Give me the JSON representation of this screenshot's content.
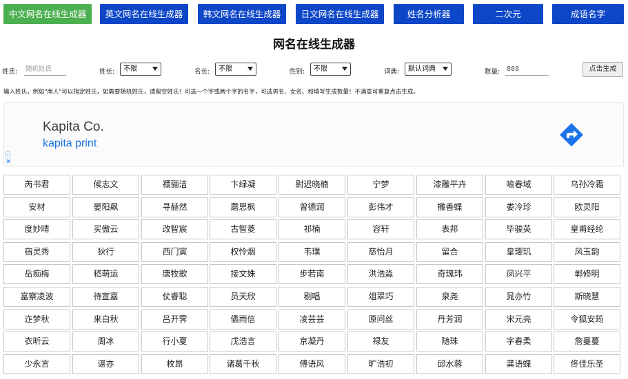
{
  "nav": {
    "tabs": [
      {
        "label": "中文网名在线生成器",
        "active": true
      },
      {
        "label": "英文网名在线生成器",
        "active": false
      },
      {
        "label": "韩文网名在线生成器",
        "active": false
      },
      {
        "label": "日文网名在线生成器",
        "active": false
      },
      {
        "label": "姓名分析器",
        "active": false
      },
      {
        "label": "二次元",
        "active": false
      },
      {
        "label": "成语名字",
        "active": false
      }
    ]
  },
  "page_title": "网名在线生成器",
  "form": {
    "surname_label": "姓氏:",
    "surname_placeholder": "随机姓氏",
    "surname_len_label": "姓长:",
    "surname_len_value": "不限",
    "name_len_label": "名长:",
    "name_len_value": "不限",
    "gender_label": "性别:",
    "gender_value": "不限",
    "dict_label": "词典:",
    "dict_value": "默认词典",
    "count_label": "数量:",
    "count_value": "888",
    "generate_label": "点击生成"
  },
  "hint": "输入姓氏，例如\"南人\"可以指定姓氏，如需要随机姓氏，请留空姓氏！可选一个字或两个字的名字，可选男名、女名、和填写生成数量！不满意可重复点击生成。",
  "ad": {
    "title": "Kapita Co.",
    "subtitle": "kapita print",
    "info_glyph": "ⓘ",
    "close_glyph": "✕"
  },
  "colors": {
    "nav_bg": "#0d47c8",
    "nav_active": "#4caf50",
    "ad_link": "#1a73e8"
  },
  "names": [
    [
      "芮书君",
      "候志文",
      "禤骊洁",
      "卞绿凝",
      "尉迟晓楠",
      "宁梦",
      "漆雕平卉",
      "喻春域",
      "乌孙冷霜"
    ],
    [
      "安材",
      "晏阳飙",
      "寻赫然",
      "蘑思枫",
      "曾德润",
      "彭伟才",
      "撒香蝶",
      "娄冷珍",
      "欧灵阳"
    ],
    [
      "度妙晴",
      "买傲云",
      "改智宸",
      "古智菱",
      "祁楠",
      "容轩",
      "表邦",
      "毕骏英",
      "皇甫经纶"
    ],
    [
      "宿灵秀",
      "狄行",
      "西门寅",
      "权怜烟",
      "韦璞",
      "慈怡月",
      "留合",
      "皇璎玑",
      "风玉韵"
    ],
    [
      "岳痴梅",
      "嵇萌运",
      "唐牧歌",
      "接文姝",
      "步若南",
      "洪浩淼",
      "奇瑰玮",
      "凤兴平",
      "郸修明"
    ],
    [
      "富察凌波",
      "待宣嘉",
      "仗睿聪",
      "员天欣",
      "剔唱",
      "俎翠巧",
      "泉尧",
      "晁亦竹",
      "斯晓慧"
    ],
    [
      "迮梦秋",
      "来白秋",
      "吕开霁",
      "僪雨信",
      "凌芸芸",
      "原问丝",
      "丹芳润",
      "宋元亮",
      "令狐安筠"
    ],
    [
      "衣昕云",
      "周冰",
      "行小夏",
      "戊浩言",
      "京凝丹",
      "禄友",
      "随珠",
      "字春柔",
      "詹曼蔓"
    ],
    [
      "少永言",
      "谌亦",
      "枚昂",
      "诸葛千秋",
      "傅语风",
      "旷浩初",
      "邱水蓉",
      "龚语蝶",
      "佟佳乐圣"
    ]
  ]
}
